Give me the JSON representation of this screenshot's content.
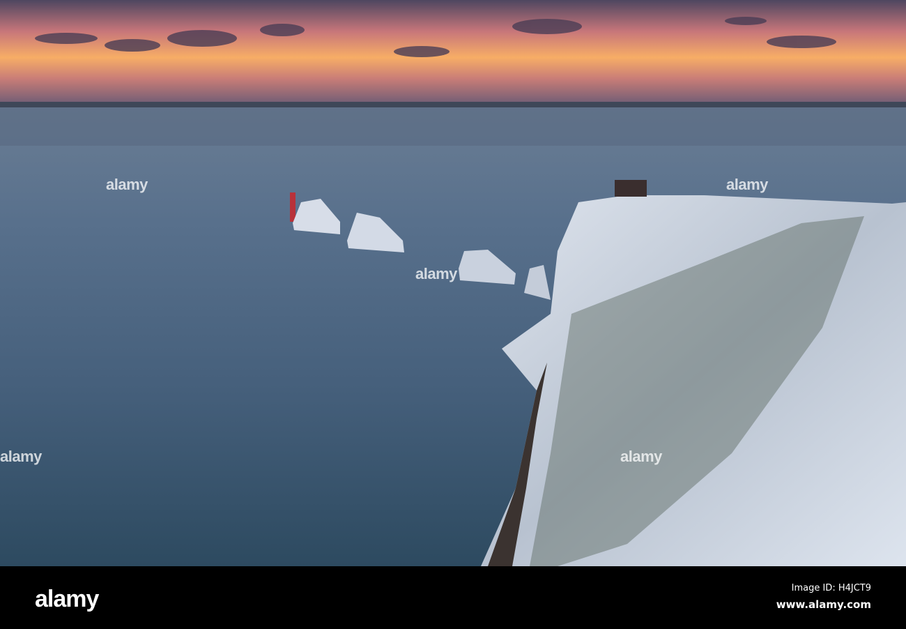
{
  "photo": {
    "colors": {
      "sky_top": "#5a4a66",
      "sky_glow": "#f6a860",
      "sea": "#3f5a78",
      "cliff": "#d9dfe8"
    }
  },
  "watermark": {
    "text": "alamy"
  },
  "footer": {
    "logo": "alamy",
    "image_id": "Image ID: H4JCT9",
    "website": "www.alamy.com"
  }
}
